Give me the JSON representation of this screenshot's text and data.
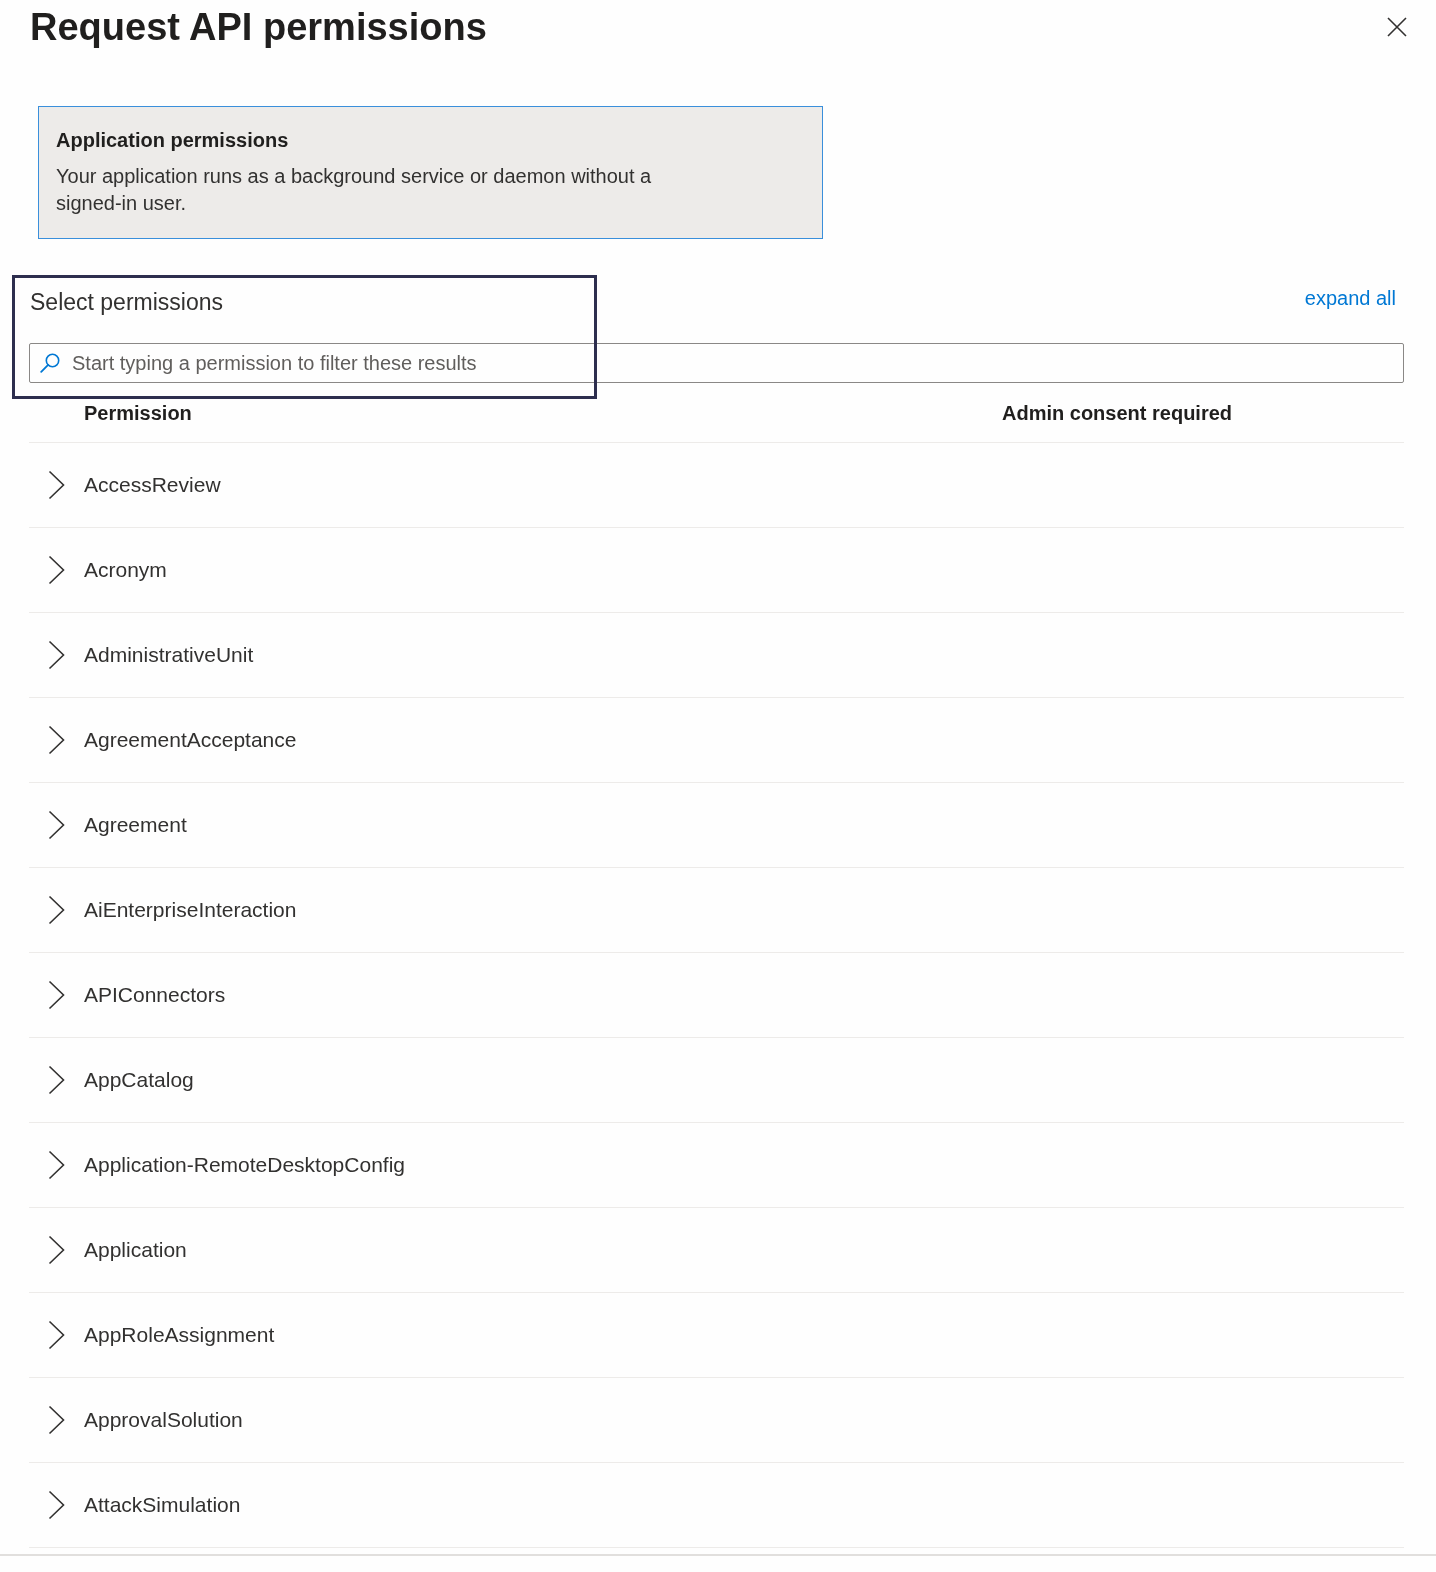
{
  "dialog": {
    "title": "Request API permissions"
  },
  "permission_type_card": {
    "title": "Application permissions",
    "description": "Your application runs as a background service or daemon without a signed-in user.",
    "selected": true
  },
  "select_permissions": {
    "title": "Select permissions",
    "expand_all": "expand all",
    "search": {
      "placeholder": "Start typing a permission to filter these results"
    }
  },
  "table": {
    "columns": [
      "Permission",
      "Admin consent required"
    ],
    "rows": [
      {
        "name": "AccessReview",
        "expanded": false
      },
      {
        "name": "Acronym",
        "expanded": false
      },
      {
        "name": "AdministrativeUnit",
        "expanded": false
      },
      {
        "name": "AgreementAcceptance",
        "expanded": false
      },
      {
        "name": "Agreement",
        "expanded": false
      },
      {
        "name": "AiEnterpriseInteraction",
        "expanded": false
      },
      {
        "name": "APIConnectors",
        "expanded": false
      },
      {
        "name": "AppCatalog",
        "expanded": false
      },
      {
        "name": "Application-RemoteDesktopConfig",
        "expanded": false
      },
      {
        "name": "Application",
        "expanded": false
      },
      {
        "name": "AppRoleAssignment",
        "expanded": false
      },
      {
        "name": "ApprovalSolution",
        "expanded": false
      },
      {
        "name": "AttackSimulation",
        "expanded": false
      }
    ]
  }
}
